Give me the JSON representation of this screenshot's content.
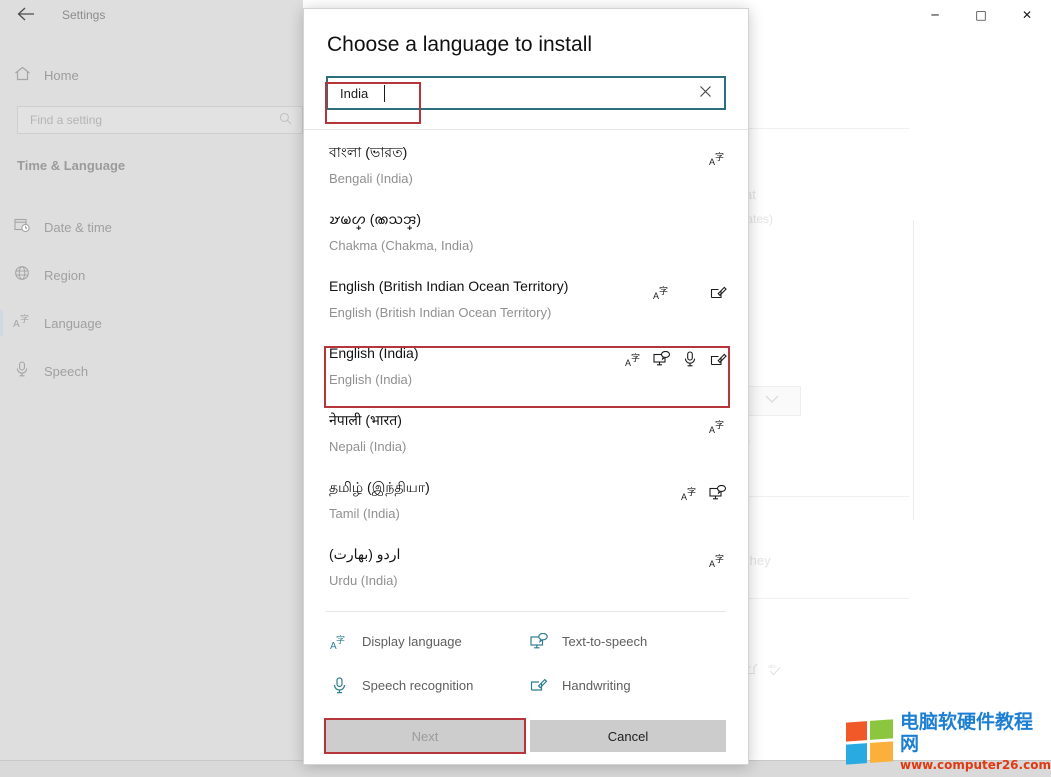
{
  "window": {
    "title": "Settings",
    "back_icon": "back-arrow-icon",
    "controls": {
      "minimize": "─",
      "maximize": "□",
      "close": "✕"
    }
  },
  "sidebar": {
    "home": {
      "label": "Home",
      "icon": "home-icon"
    },
    "search": {
      "placeholder": "Find a setting",
      "icon": "search-icon"
    },
    "group_title": "Time & Language",
    "items": [
      {
        "label": "Date & time",
        "icon": "calendar-clock-icon",
        "selected": false
      },
      {
        "label": "Region",
        "icon": "globe-icon",
        "selected": false
      },
      {
        "label": "Language",
        "icon": "display-language-icon",
        "selected": true
      },
      {
        "label": "Speech",
        "icon": "microphone-icon",
        "selected": false
      }
    ]
  },
  "background_content": {
    "fragment_1": "at",
    "fragment_2": "tates)",
    "fragment_3": "they",
    "fragment_4": "s"
  },
  "dialog": {
    "title": "Choose a language to install",
    "search": {
      "value": "India",
      "placeholder": "",
      "clear_icon": "close-icon",
      "border_color": "#2b6e7e"
    },
    "annotation_color": "#b5353b",
    "languages": [
      {
        "native": "বাংলা (ভারত)",
        "english": "Bengali (India)",
        "features": [
          "display-language"
        ],
        "highlighted": false
      },
      {
        "native": "𑄏𑄟𑄦𑄳 (𑄚𑄥𑄞𑄳)",
        "english": "Chakma (Chakma, India)",
        "features": [],
        "highlighted": false
      },
      {
        "native": "English (British Indian Ocean Territory)",
        "english": "English (British Indian Ocean Territory)",
        "features": [
          "display-language",
          "handwriting"
        ],
        "highlighted": false
      },
      {
        "native": "English (India)",
        "english": "English (India)",
        "features": [
          "display-language",
          "text-to-speech",
          "speech-recognition",
          "handwriting"
        ],
        "highlighted": true
      },
      {
        "native": "नेपाली (भारत)",
        "english": "Nepali (India)",
        "features": [
          "display-language"
        ],
        "highlighted": false
      },
      {
        "native": "தமிழ் (இந்தியா)",
        "english": "Tamil (India)",
        "features": [
          "display-language",
          "text-to-speech"
        ],
        "highlighted": false
      },
      {
        "native": "اردو (بھارت)",
        "english": "Urdu (India)",
        "features": [
          "display-language"
        ],
        "highlighted": false
      }
    ],
    "legend": [
      {
        "label": "Display language",
        "icon": "display-language-icon"
      },
      {
        "label": "Text-to-speech",
        "icon": "text-to-speech-icon"
      },
      {
        "label": "Speech recognition",
        "icon": "microphone-icon"
      },
      {
        "label": "Handwriting",
        "icon": "handwriting-icon"
      }
    ],
    "legend_icon_color": "#2f7d91",
    "buttons": {
      "next": "Next",
      "cancel": "Cancel"
    }
  },
  "watermark": {
    "chinese": "电脑软硬件教程网",
    "url": "www.computer26.com",
    "logo_colors": [
      "#f05a28",
      "#8cc63e",
      "#29abe2",
      "#fbb03b"
    ],
    "text_color": "#1d7fd4",
    "url_color": "#e03a12"
  }
}
